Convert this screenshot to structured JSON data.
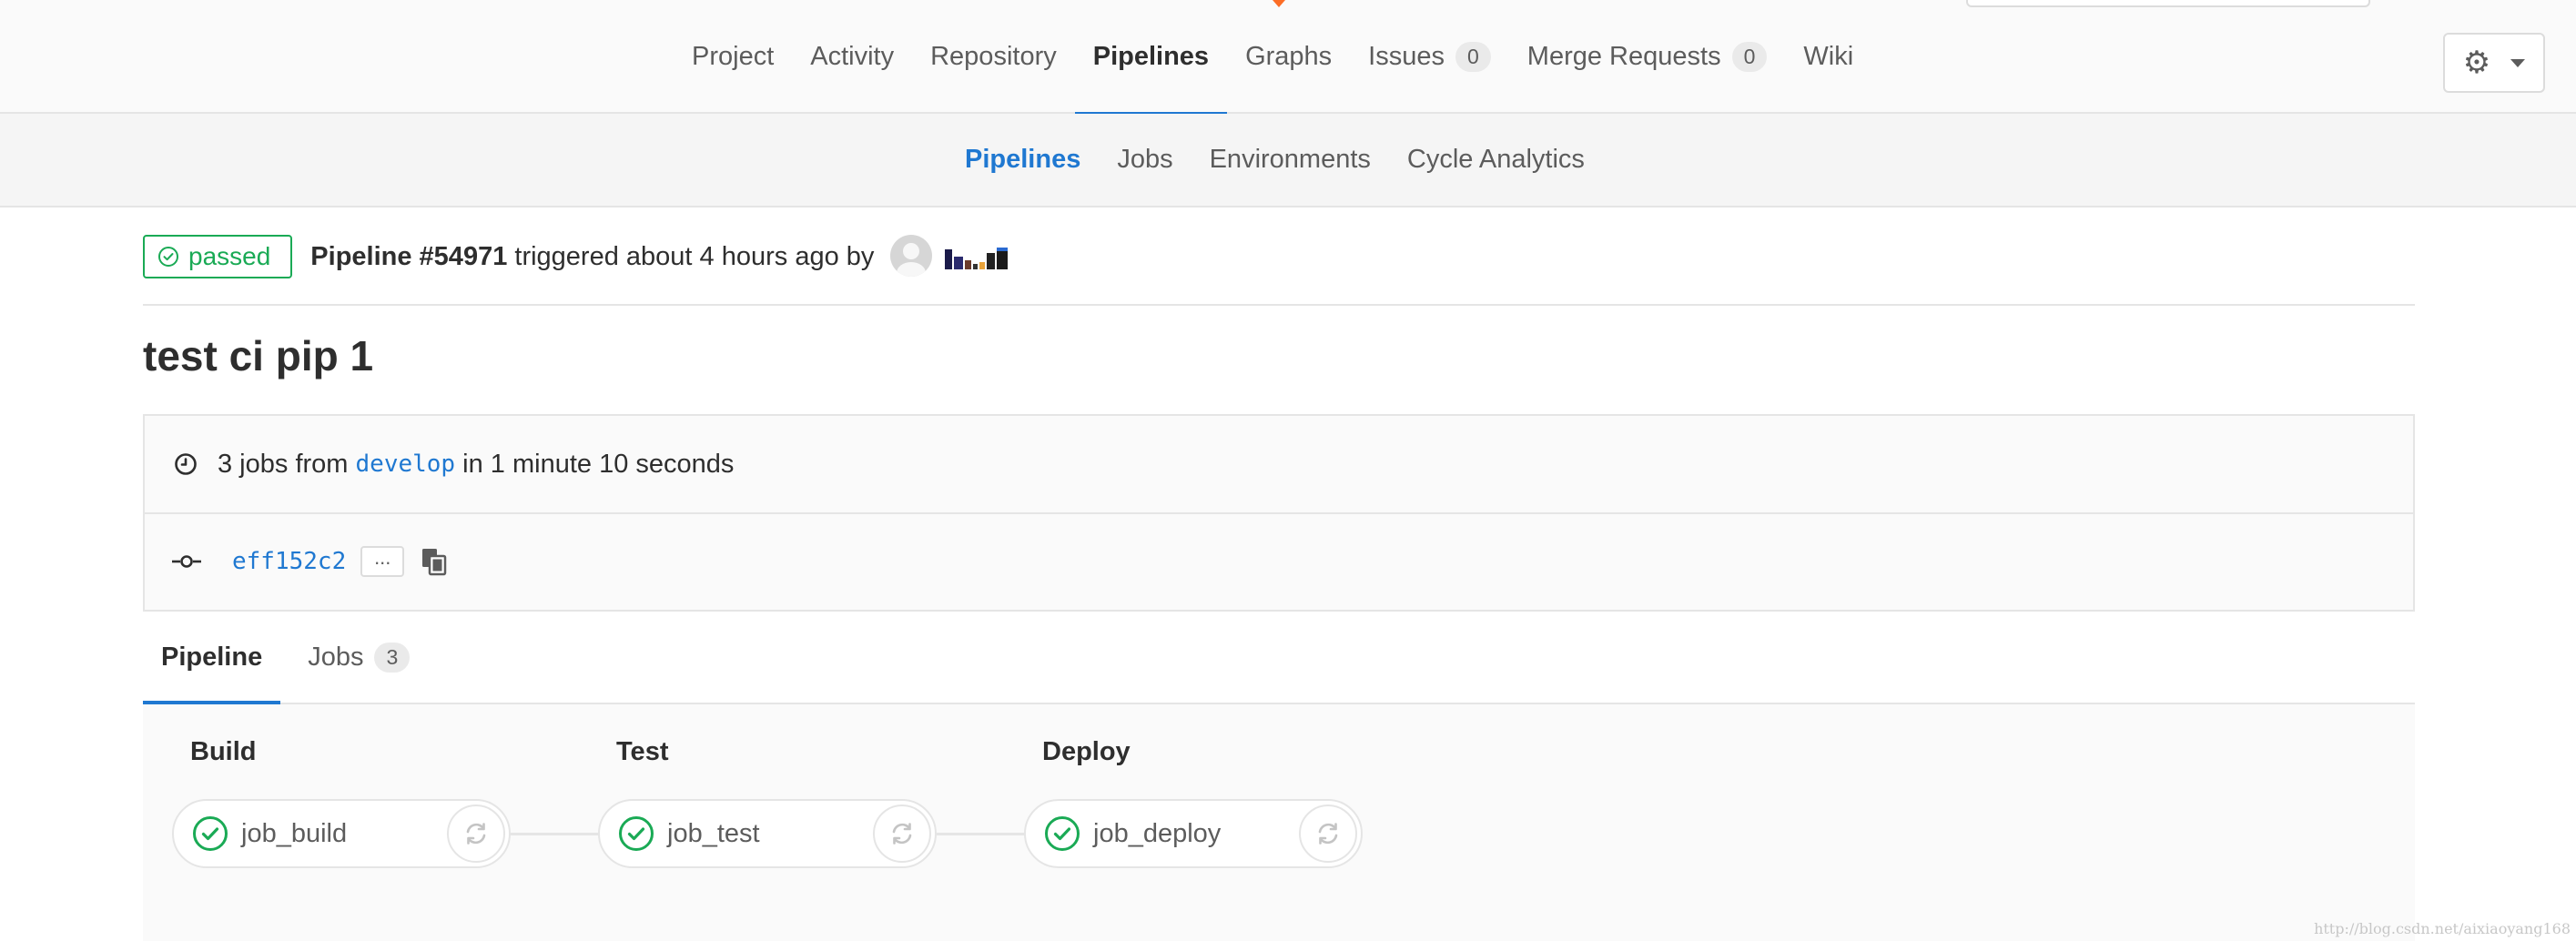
{
  "top_nav": {
    "items": [
      {
        "label": "Project"
      },
      {
        "label": "Activity"
      },
      {
        "label": "Repository"
      },
      {
        "label": "Pipelines",
        "active": true
      },
      {
        "label": "Graphs"
      },
      {
        "label": "Issues",
        "count": "0"
      },
      {
        "label": "Merge Requests",
        "count": "0"
      },
      {
        "label": "Wiki"
      }
    ],
    "settings_icon": "gear-icon",
    "settings_caret_icon": "chevron-down-icon"
  },
  "sub_nav": {
    "items": [
      {
        "label": "Pipelines",
        "active": true
      },
      {
        "label": "Jobs"
      },
      {
        "label": "Environments"
      },
      {
        "label": "Cycle Analytics"
      }
    ]
  },
  "pipeline_header": {
    "status": "passed",
    "pipeline_label": "Pipeline #54971",
    "triggered_text": "triggered about 4 hours ago by"
  },
  "commit": {
    "title": "test ci pip 1",
    "jobs_prefix": "3 jobs from",
    "branch": "develop",
    "duration_text": "in 1 minute 10 seconds",
    "sha": "eff152c2",
    "ellipsis": "..."
  },
  "tabs": [
    {
      "label": "Pipeline",
      "active": true
    },
    {
      "label": "Jobs",
      "count": "3"
    }
  ],
  "stages": [
    {
      "title": "Build",
      "job": "job_build",
      "status": "success"
    },
    {
      "title": "Test",
      "job": "job_test",
      "status": "success"
    },
    {
      "title": "Deploy",
      "job": "job_deploy",
      "status": "success"
    }
  ],
  "colors": {
    "success": "#1aaa55",
    "accent": "#1f78d1",
    "brand_orange": "#fc6d26"
  },
  "watermark": "http://blog.csdn.net/aixiaoyang168"
}
